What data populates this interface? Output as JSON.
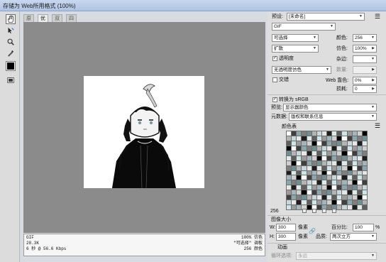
{
  "window": {
    "title": "存储为 Web所用格式 (100%)"
  },
  "tools": [
    "hand-tool",
    "slice-select-tool",
    "zoom-tool",
    "eyedropper-tool",
    "eyedropper-color",
    "toggle-slices"
  ],
  "tabs": [
    {
      "label": "原稿",
      "active": false
    },
    {
      "label": "优化",
      "active": true
    },
    {
      "label": "双联",
      "active": false
    },
    {
      "label": "四联",
      "active": false
    }
  ],
  "info": {
    "format": "GIF",
    "size": "28.3K",
    "time": "6 秒 @ 56.6 Kbps",
    "dither_pct": "100% 仿色",
    "palette": "\"可选择\" 调板",
    "colors": "256 颜色"
  },
  "panel": {
    "preset_label": "预设:",
    "preset_value": "[未命名]",
    "format_value": "GIF",
    "reduction_value": "可选择",
    "colors_label": "颜色:",
    "colors_value": "256",
    "dither_algo_value": "扩散",
    "dither_label": "仿色:",
    "dither_value": "100%",
    "transparency_label": "透明度",
    "transparency_checked": true,
    "matte_label": "杂边:",
    "trans_dither_value": "无透明度仿色",
    "amount_label": "数量:",
    "interlaced_label": "交错",
    "interlaced_checked": false,
    "web_snap_label": "Web 靠色:",
    "web_snap_value": "0%",
    "lossy_label": "损耗:",
    "lossy_value": "0",
    "srgb_label": "转换为 sRGB",
    "srgb_checked": true,
    "preview_label": "预览:",
    "preview_value": "显示器颜色",
    "metadata_label": "元数据:",
    "metadata_value": "版权和联系信息",
    "color_table_label": "颜色表",
    "color_count": "256",
    "image_size_label": "图像大小",
    "width_label": "W:",
    "width_value": "300",
    "height_label": "H:",
    "height_value": "300",
    "pixel_unit": "像素",
    "percent_label": "百分比:",
    "percent_value": "100",
    "percent_unit": "%",
    "quality_label": "品质:",
    "quality_value": "两次立方",
    "animation_label": "动画",
    "loop_label": "循环选项:",
    "loop_value": "永远"
  },
  "colors": {
    "accent": "#aec3e3",
    "palette": [
      "#ffffff",
      "#e6e6e6",
      "#cfcfcf",
      "#b4b4b4",
      "#9a9a9a",
      "#7f7f7f",
      "#5f5f5f",
      "#3f3f3f",
      "#1e1e1e",
      "#000000",
      "#c7d8dc",
      "#9fb7bd",
      "#6f8f97",
      "#cde6ea",
      "#8aa6ae",
      "#dfe9ea"
    ]
  }
}
